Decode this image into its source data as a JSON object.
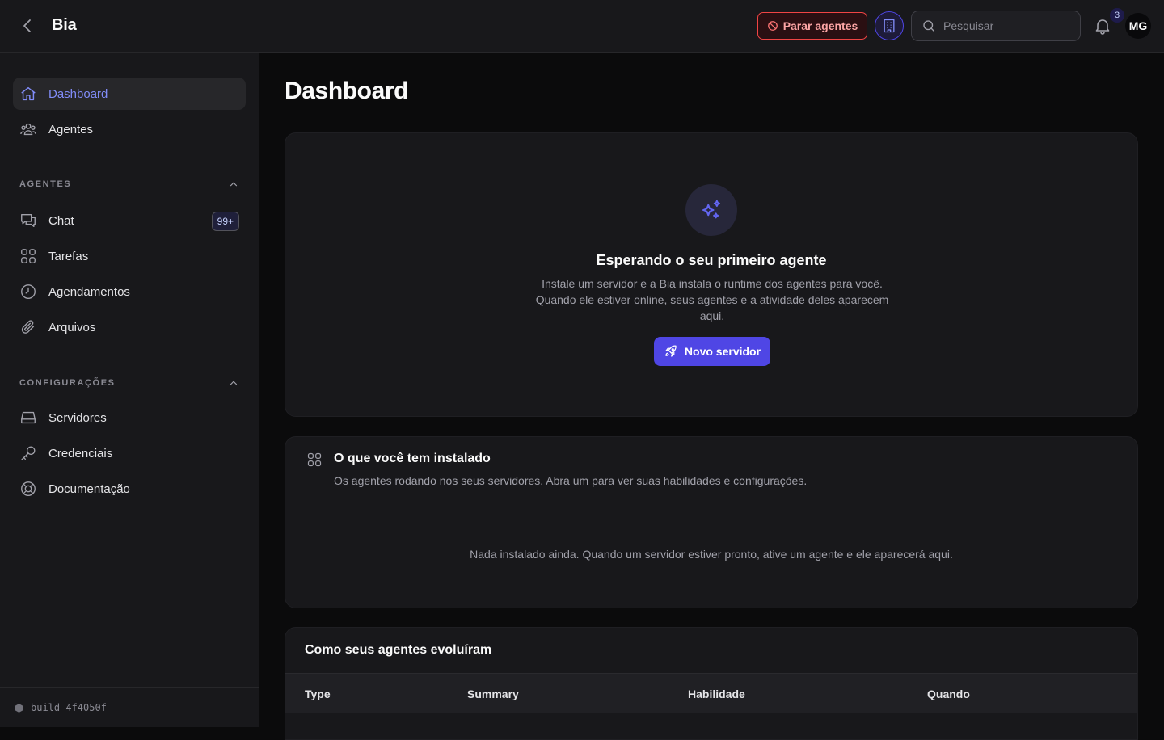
{
  "topbar": {
    "app_title": "Bia",
    "stop_label": "Parar agentes",
    "search_placeholder": "Pesquisar",
    "notification_count": "3",
    "avatar_initials": "MG"
  },
  "sidebar": {
    "main_items": [
      {
        "label": "Dashboard",
        "icon": "home-icon",
        "active": true
      },
      {
        "label": "Agentes",
        "icon": "users-icon"
      }
    ],
    "section_agents": {
      "title": "AGENTES",
      "items": [
        {
          "label": "Chat",
          "icon": "chat-icon",
          "badge": "99+"
        },
        {
          "label": "Tarefas",
          "icon": "grid-icon"
        },
        {
          "label": "Agendamentos",
          "icon": "clock-icon"
        },
        {
          "label": "Arquivos",
          "icon": "paperclip-icon"
        }
      ]
    },
    "section_config": {
      "title": "CONFIGURAÇÕES",
      "items": [
        {
          "label": "Servidores",
          "icon": "server-icon"
        },
        {
          "label": "Credenciais",
          "icon": "key-icon"
        },
        {
          "label": "Documentação",
          "icon": "lifebuoy-icon"
        }
      ]
    },
    "build": "build 4f4050f"
  },
  "main": {
    "title": "Dashboard",
    "empty_state": {
      "icon": "sparkles-icon",
      "title": "Esperando o seu primeiro agente",
      "description": "Instale um servidor e a Bia instala o runtime dos agentes para você. Quando ele estiver online, seus agentes e a atividade deles aparecem aqui.",
      "button_label": "Novo servidor"
    },
    "installed": {
      "title": "O que você tem instalado",
      "description": "Os agentes rodando nos seus servidores. Abra um para ver suas habilidades e configurações.",
      "empty": "Nada instalado ainda. Quando um servidor estiver pronto, ative um agente e ele aparecerá aqui."
    },
    "evolution": {
      "title": "Como seus agentes evoluíram",
      "columns": [
        "Type",
        "Summary",
        "Habilidade",
        "Quando"
      ]
    }
  },
  "colors": {
    "accent": "#4f46e5",
    "accent_text": "#818cf8",
    "danger": "#ef4444",
    "background": "#0b0b0c",
    "surface": "#18181b"
  }
}
